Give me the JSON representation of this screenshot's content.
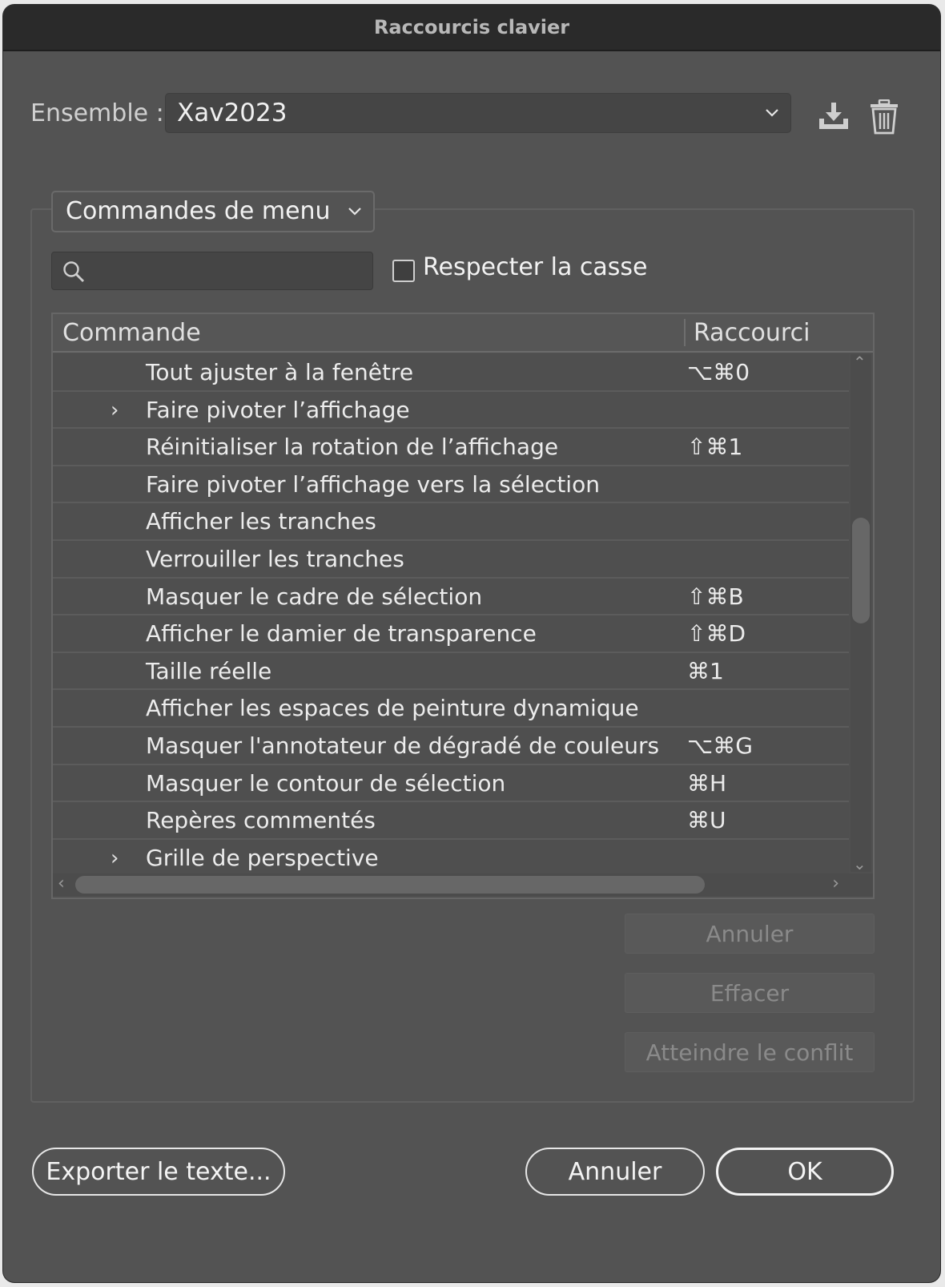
{
  "window": {
    "title": "Raccourcis clavier"
  },
  "ensemble": {
    "label": "Ensemble :",
    "value": "Xav2023"
  },
  "commands_select": {
    "value": "Commandes de menu"
  },
  "search": {
    "placeholder": ""
  },
  "match_case": {
    "label": "Respecter la casse",
    "checked": false
  },
  "table": {
    "columns": [
      "Commande",
      "Raccourci"
    ],
    "rows": [
      {
        "expandable": false,
        "command": "Tout ajuster à la fenêtre",
        "shortcut": "⌥⌘0"
      },
      {
        "expandable": true,
        "command": "Faire pivoter l’affichage",
        "shortcut": ""
      },
      {
        "expandable": false,
        "command": "Réinitialiser la rotation de l’affichage",
        "shortcut": "⇧⌘1"
      },
      {
        "expandable": false,
        "command": "Faire pivoter l’affichage vers la sélection",
        "shortcut": ""
      },
      {
        "expandable": false,
        "command": "Afficher les tranches",
        "shortcut": ""
      },
      {
        "expandable": false,
        "command": "Verrouiller les tranches",
        "shortcut": ""
      },
      {
        "expandable": false,
        "command": "Masquer le cadre de sélection",
        "shortcut": "⇧⌘B"
      },
      {
        "expandable": false,
        "command": "Afficher le damier de transparence",
        "shortcut": "⇧⌘D"
      },
      {
        "expandable": false,
        "command": "Taille réelle",
        "shortcut": "⌘1"
      },
      {
        "expandable": false,
        "command": "Afficher les espaces de peinture dynamique",
        "shortcut": ""
      },
      {
        "expandable": false,
        "command": "Masquer l'annotateur de dégradé de couleurs",
        "shortcut": "⌥⌘G"
      },
      {
        "expandable": false,
        "command": "Masquer le contour de sélection",
        "shortcut": "⌘H"
      },
      {
        "expandable": false,
        "command": "Repères commentés",
        "shortcut": "⌘U"
      },
      {
        "expandable": true,
        "command": "Grille de perspective",
        "shortcut": ""
      }
    ]
  },
  "side_buttons": {
    "undo": "Annuler",
    "clear": "Effacer",
    "goto_conflict": "Atteindre le conflit"
  },
  "footer": {
    "export": "Exporter le texte...",
    "cancel": "Annuler",
    "ok": "OK"
  }
}
